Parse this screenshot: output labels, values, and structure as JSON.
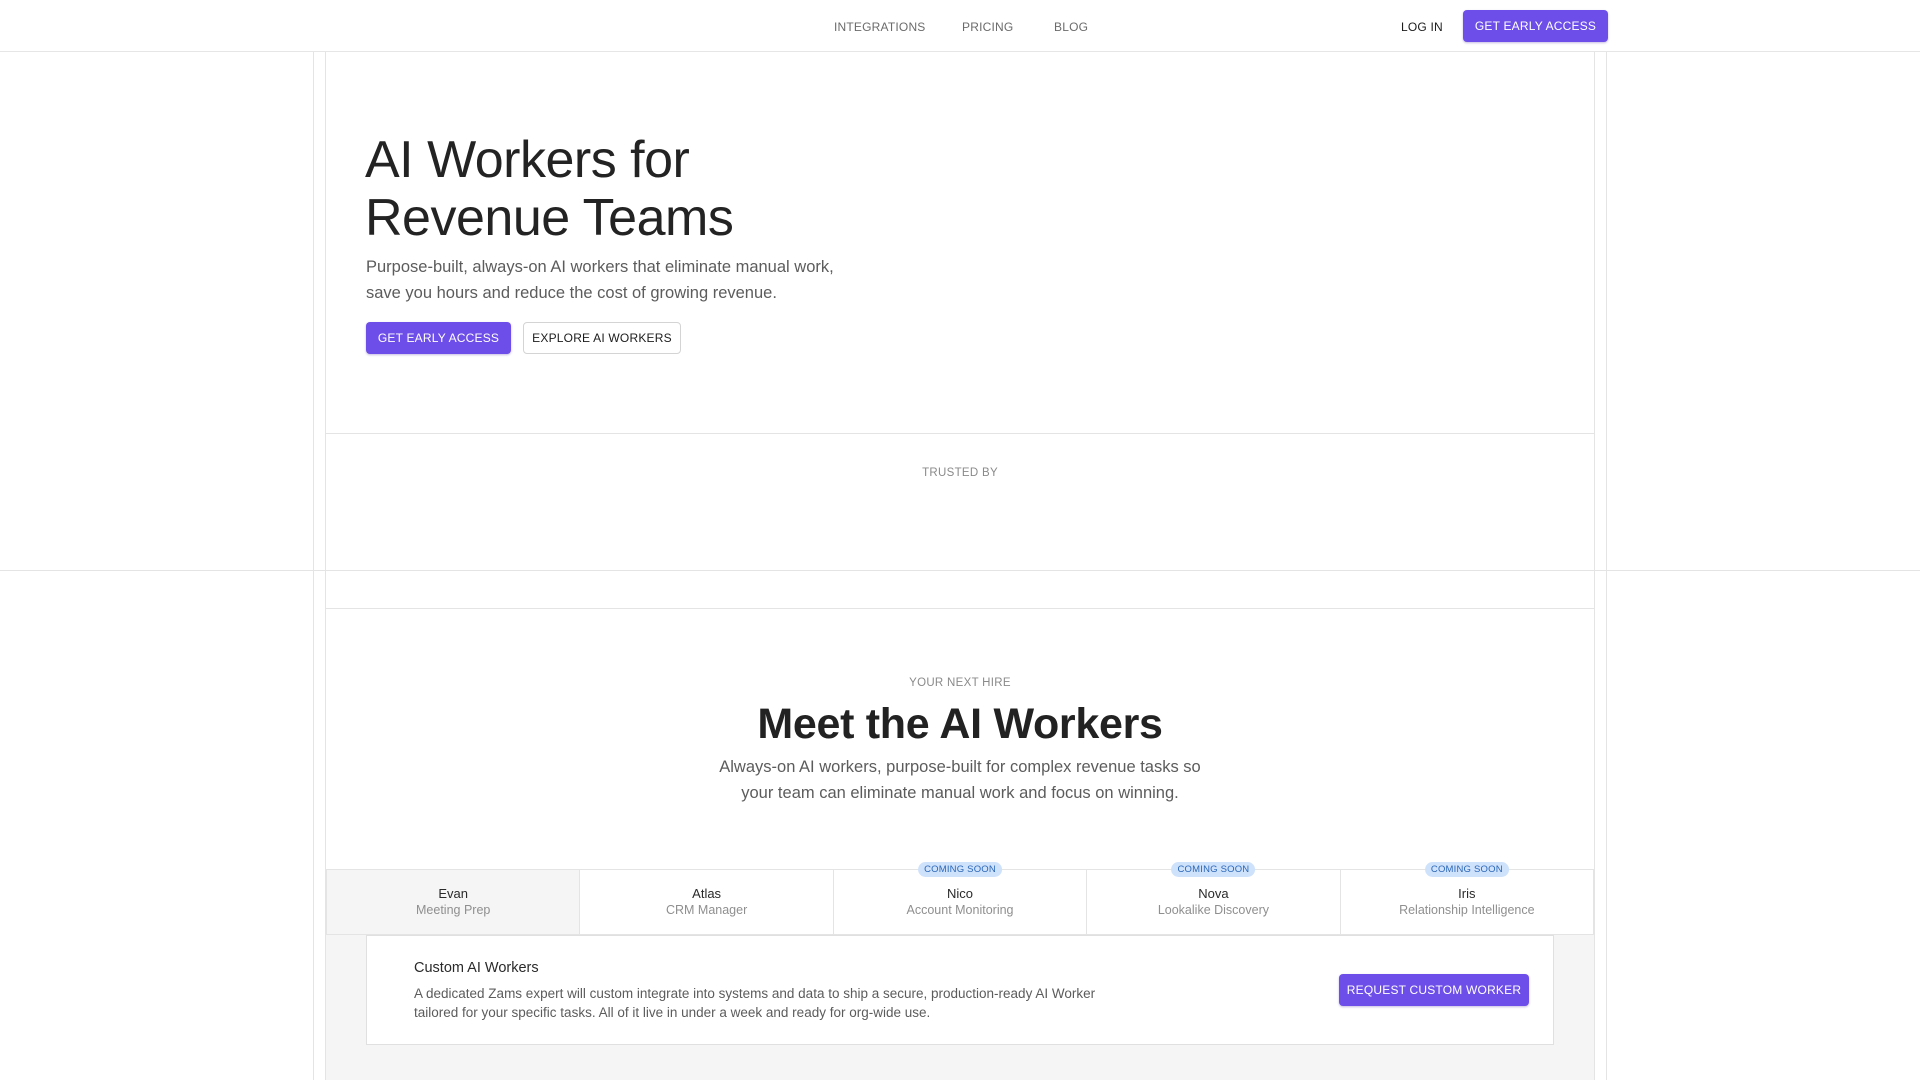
{
  "header": {
    "nav": [
      "INTEGRATIONS",
      "PRICING",
      "BLOG"
    ],
    "login_label": "LOG IN",
    "cta_label": "GET EARLY ACCESS"
  },
  "hero": {
    "title_line1": "AI Workers for",
    "title_line2": "Revenue Teams",
    "subtitle_line1": "Purpose-built, always-on AI workers that eliminate manual work,",
    "subtitle_line2": "save you hours and reduce the cost of growing revenue.",
    "primary_button": "GET EARLY ACCESS",
    "secondary_button": "EXPLORE AI WORKERS"
  },
  "trusted": {
    "label": "TRUSTED BY"
  },
  "workers_section": {
    "eyebrow": "YOUR NEXT HIRE",
    "title": "Meet the AI Workers",
    "subtitle_line1": "Always-on AI workers, purpose-built for complex revenue tasks so",
    "subtitle_line2": "your team can eliminate manual work and focus on winning.",
    "workers": [
      {
        "name": "Evan",
        "role": "Meeting Prep",
        "badge": ""
      },
      {
        "name": "Atlas",
        "role": "CRM Manager",
        "badge": ""
      },
      {
        "name": "Nico",
        "role": "Account Monitoring",
        "badge": "COMING SOON"
      },
      {
        "name": "Nova",
        "role": "Lookalike Discovery",
        "badge": "COMING SOON"
      },
      {
        "name": "Iris",
        "role": "Relationship Intelligence",
        "badge": "COMING SOON"
      }
    ],
    "custom": {
      "title": "Custom AI Workers",
      "desc_line1": "A dedicated Zams expert will custom integrate into systems and data to ship a secure, production-ready AI Worker",
      "desc_line2": "tailored for your specific tasks. All of it live in under a week and ready for org-wide use.",
      "button": "REQUEST CUSTOM WORKER"
    }
  },
  "colors": {
    "accent": "#6d4ee8",
    "badge_bg": "#cfe2fb",
    "badge_text": "#2b67b8",
    "border": "#e4e4e4"
  }
}
